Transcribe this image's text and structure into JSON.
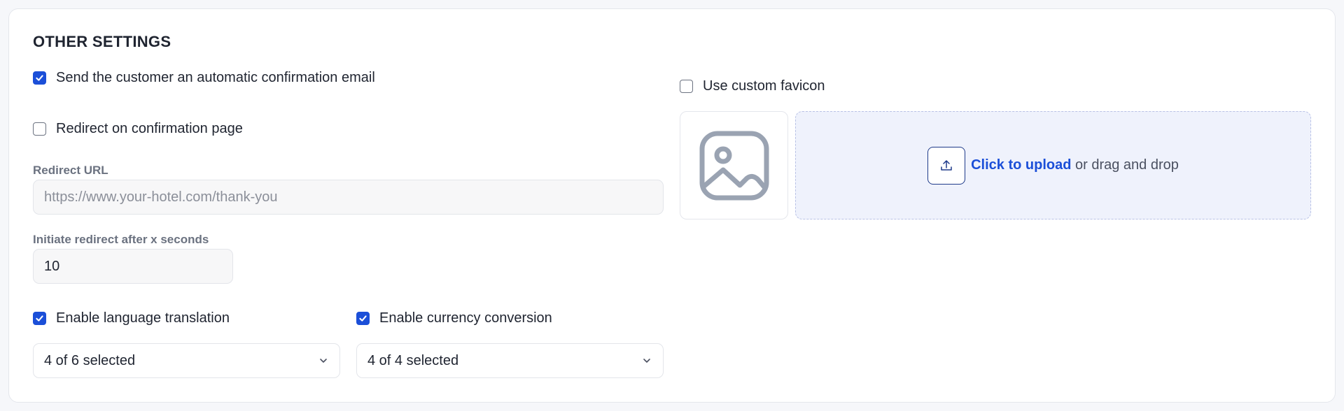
{
  "section": {
    "title": "OTHER SETTINGS"
  },
  "options": {
    "confirmation_email": {
      "label": "Send the customer an automatic confirmation email",
      "checked": true
    },
    "redirect": {
      "label": "Redirect on confirmation page",
      "checked": false
    },
    "language_translation": {
      "label": "Enable language translation",
      "checked": true
    },
    "currency_conversion": {
      "label": "Enable currency conversion",
      "checked": true
    },
    "custom_favicon": {
      "label": "Use custom favicon",
      "checked": false
    }
  },
  "redirect_url": {
    "label": "Redirect URL",
    "value": "",
    "placeholder": "https://www.your-hotel.com/thank-you"
  },
  "redirect_delay": {
    "label": "Initiate redirect after x seconds",
    "value": "10"
  },
  "language_select": {
    "selected": "4 of 6 selected",
    "icon": "chevron-down-icon"
  },
  "currency_select": {
    "selected": "4 of 4 selected",
    "icon": "chevron-down-icon"
  },
  "favicon": {
    "preview_icon": "image-placeholder-icon",
    "upload_icon": "upload-icon",
    "upload_link": "Click to upload",
    "upload_hint": "or drag and drop"
  },
  "colors": {
    "accent": "#1b4fd8",
    "dropzone_bg": "#eff2fc",
    "muted_label": "#6b7280"
  }
}
